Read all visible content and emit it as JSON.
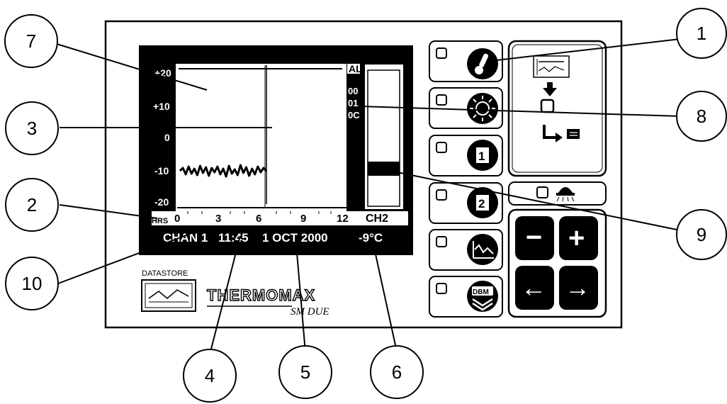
{
  "callouts": {
    "c1": "1",
    "c2": "2",
    "c3": "3",
    "c4": "4",
    "c5": "5",
    "c6": "6",
    "c7": "7",
    "c8": "8",
    "c9": "9",
    "c10": "10"
  },
  "screen": {
    "y_ticks": [
      "+20",
      "+10",
      "0",
      "-10",
      "-20"
    ],
    "x_unit": "HRS",
    "x_ticks": [
      "0",
      "3",
      "6",
      "9",
      "12"
    ],
    "alarm_label": "AL",
    "alarm_codes": [
      "00",
      "01",
      "0C"
    ],
    "channel_label": "CH2",
    "status": {
      "channel": "CHAN 1",
      "time": "11:45",
      "date": "1 OCT 2000",
      "temperature": "-9°C"
    }
  },
  "branding": {
    "datastore_label": "DATASTORE",
    "brand_name": "THERMOMAX",
    "model_name": "SM DUE"
  },
  "buttons": {
    "one_label": "1",
    "two_label": "2",
    "dbm_label": "DBM",
    "minus_label": "−",
    "plus_label": "+",
    "left_label": "←",
    "right_label": "→"
  },
  "colors": {
    "ink": "#000000",
    "paper": "#ffffff",
    "panel_edge": "#111111"
  }
}
